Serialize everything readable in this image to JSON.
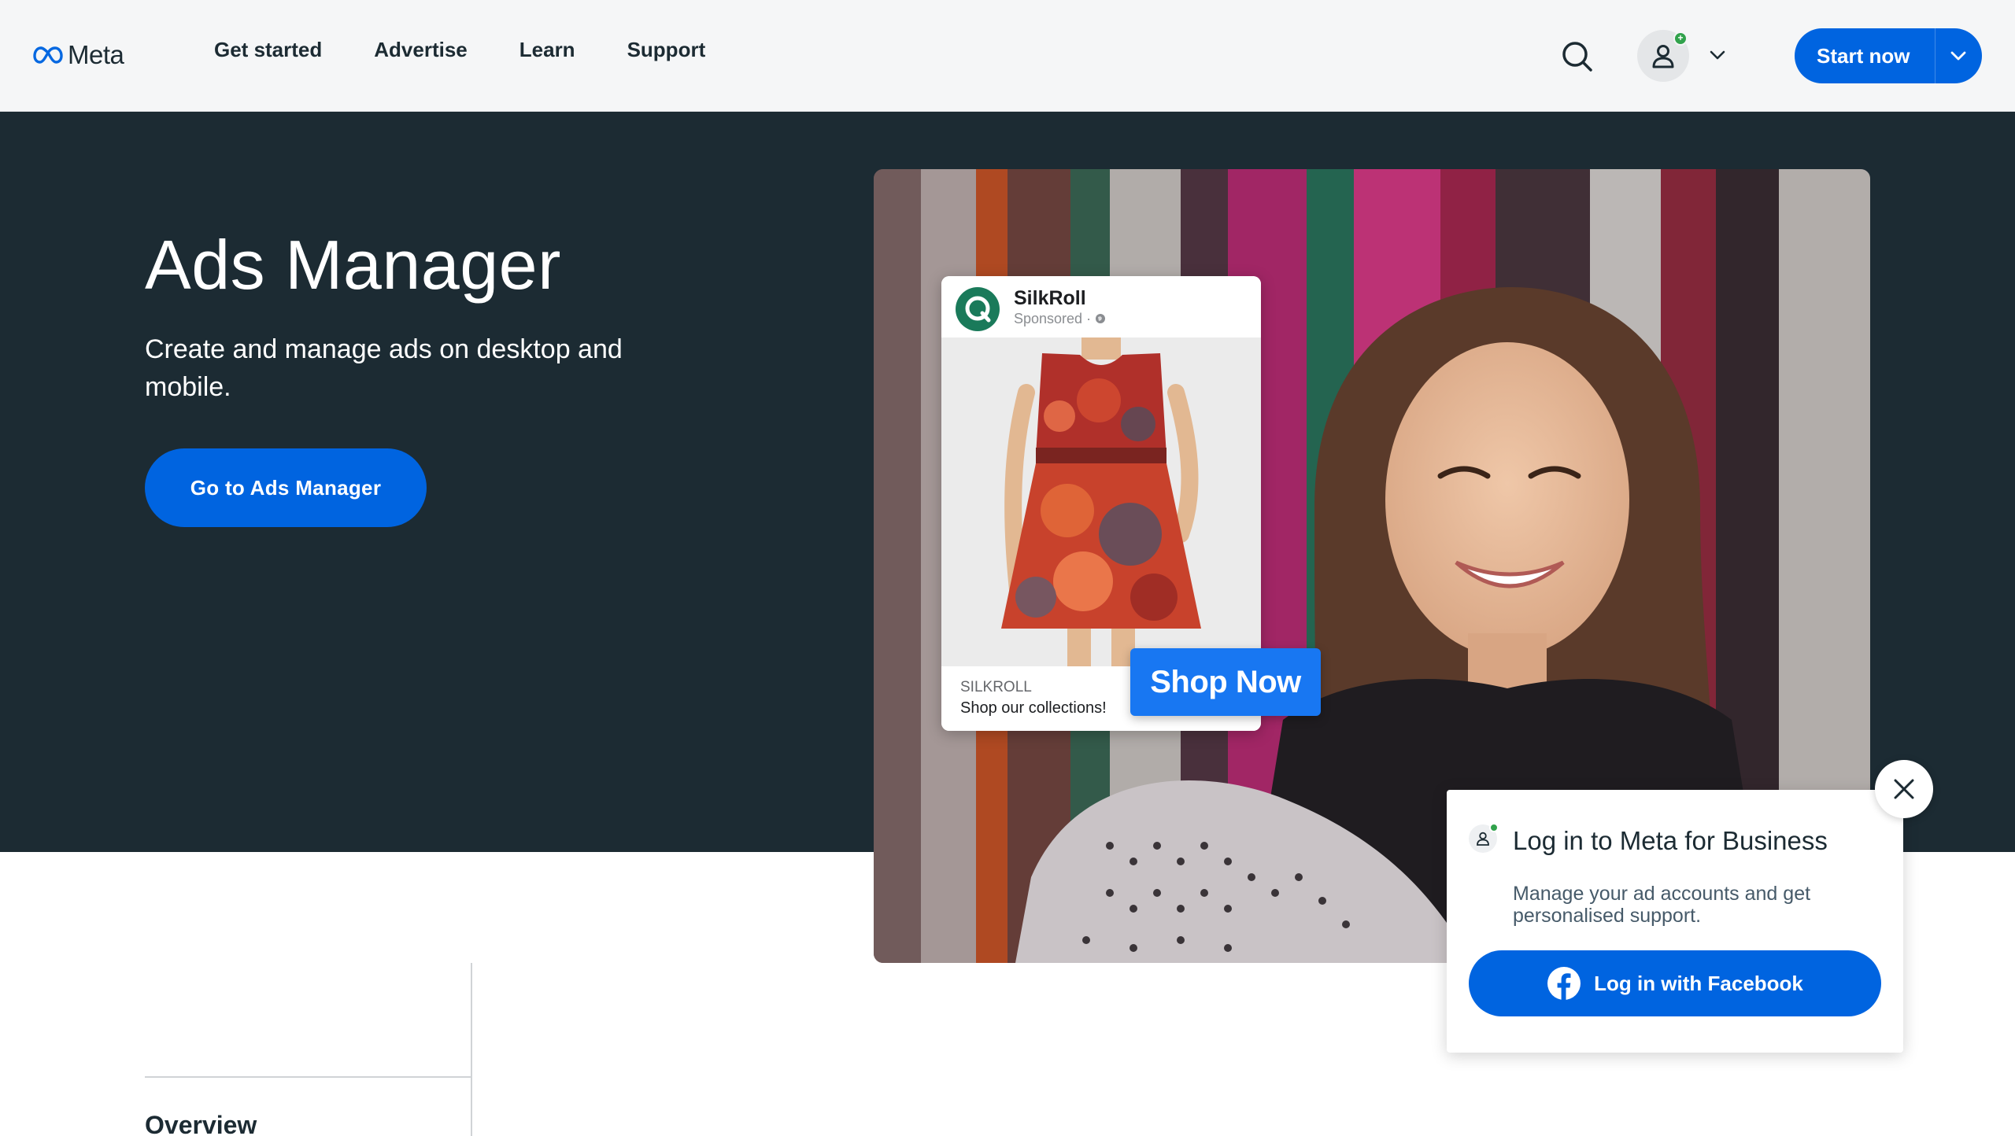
{
  "header": {
    "logo_text": "Meta",
    "nav": [
      "Get started",
      "Advertise",
      "Learn",
      "Support"
    ],
    "account_badge": "+",
    "start_label": "Start now"
  },
  "hero": {
    "title": "Ads Manager",
    "subtitle": "Create and manage ads on desktop and mobile.",
    "cta_label": "Go to Ads Manager"
  },
  "ad": {
    "brand": "SilkRoll",
    "sponsored": "Sponsored · ",
    "domain": "SILKROLL",
    "caption": "Shop our collections!",
    "cta": "Shop Now"
  },
  "content": {
    "overview_label": "Overview"
  },
  "login_popup": {
    "title": "Log in to Meta for Business",
    "description": "Manage your ad accounts and get personalised support.",
    "button_label": "Log in with Facebook"
  },
  "colors": {
    "brand_blue": "#0064e0",
    "hero_bg": "#1c2b33",
    "nav_bg": "#f5f6f7",
    "status_green": "#31a24c",
    "facebook_blue": "#1877f2"
  },
  "icons": {
    "logo": "meta-infinity-icon",
    "search": "search-icon",
    "account": "person-icon",
    "dropdown": "chevron-down-icon",
    "close": "close-icon",
    "facebook": "facebook-icon"
  }
}
